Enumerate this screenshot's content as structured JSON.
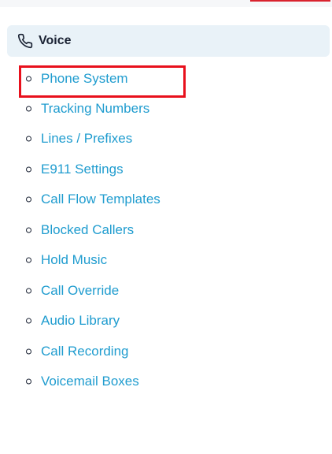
{
  "section": {
    "title": "Voice",
    "icon": "phone-icon",
    "header_bg": "#e9f2f8"
  },
  "nav_items": [
    {
      "label": "Phone System",
      "highlighted": true
    },
    {
      "label": "Tracking Numbers"
    },
    {
      "label": "Lines / Prefixes"
    },
    {
      "label": "E911 Settings"
    },
    {
      "label": "Call Flow Templates"
    },
    {
      "label": "Blocked Callers"
    },
    {
      "label": "Hold Music"
    },
    {
      "label": "Call Override"
    },
    {
      "label": "Audio Library"
    },
    {
      "label": "Call Recording"
    },
    {
      "label": "Voicemail Boxes"
    }
  ],
  "colors": {
    "link": "#1f9ccf",
    "highlight": "#e8101c",
    "accent": "#d9232e"
  }
}
